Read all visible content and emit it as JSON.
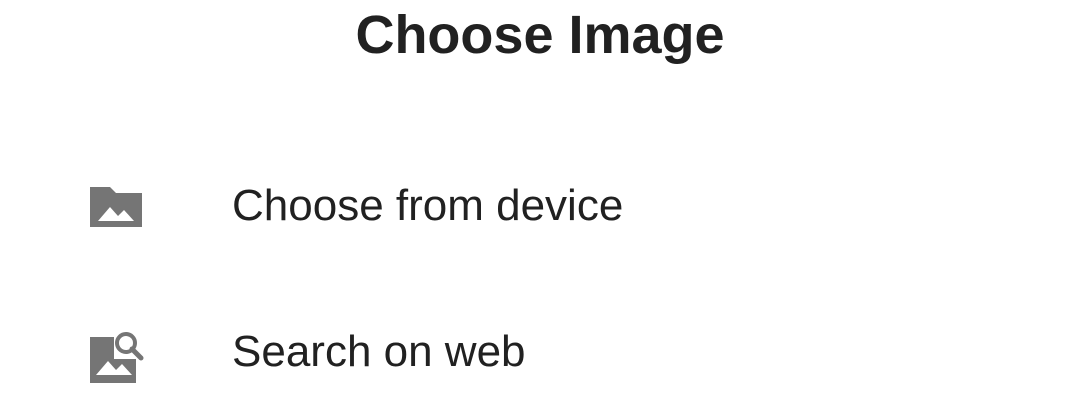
{
  "dialog": {
    "title": "Choose Image",
    "options": [
      {
        "icon": "folder-image-icon",
        "label": "Choose from device"
      },
      {
        "icon": "image-search-icon",
        "label": "Search on web"
      }
    ]
  },
  "colors": {
    "icon": "#757575",
    "text": "#212121",
    "background": "#ffffff"
  }
}
